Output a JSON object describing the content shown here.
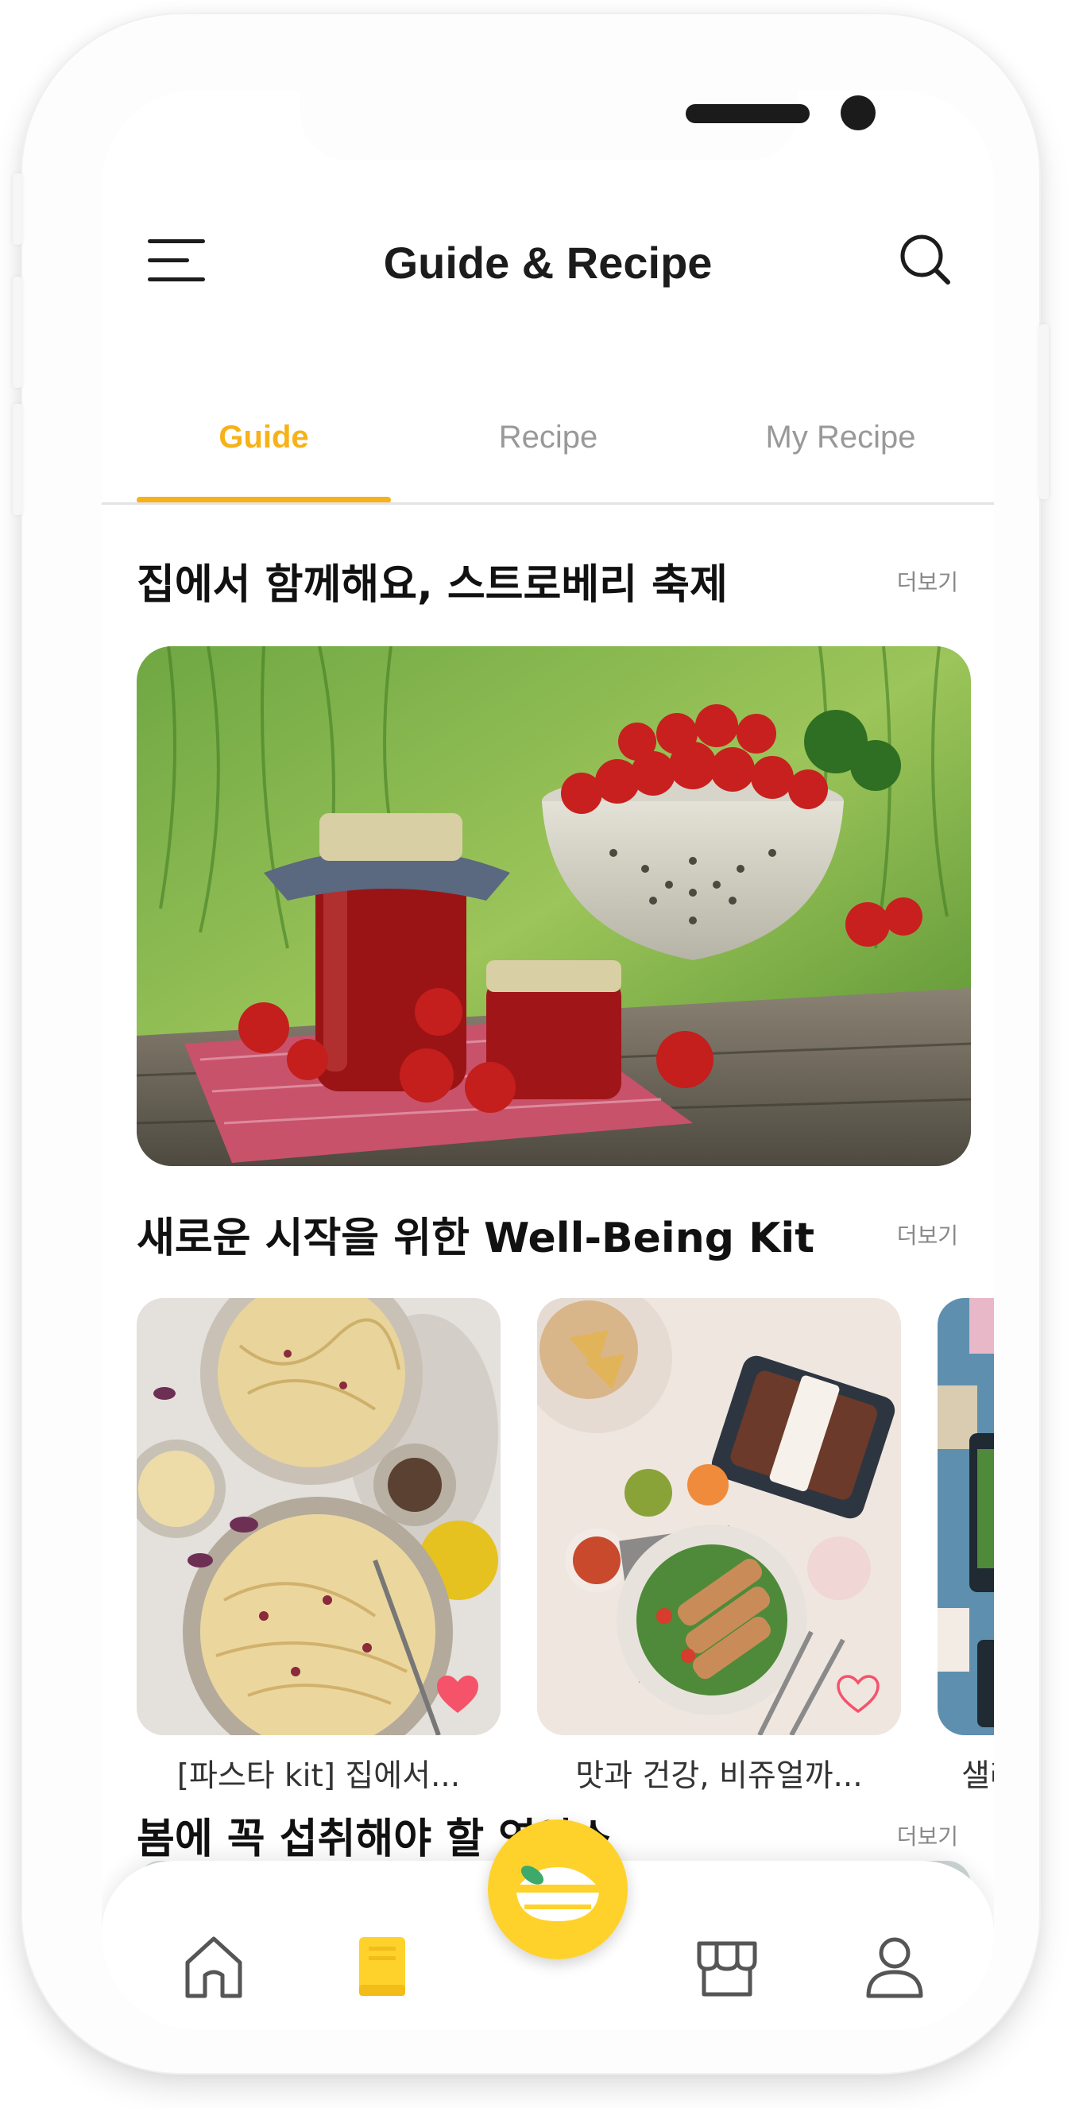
{
  "header": {
    "title": "Guide & Recipe"
  },
  "tabs": [
    {
      "label": "Guide",
      "active": true
    },
    {
      "label": "Recipe",
      "active": false
    },
    {
      "label": "My Recipe",
      "active": false
    }
  ],
  "sections": [
    {
      "title": "집에서 함께해요, 스트로베리 축제",
      "more": "더보기"
    },
    {
      "title": "새로운 시작을 위한  Well-Being  Kit",
      "more": "더보기",
      "cards": [
        {
          "caption": "[파스타 kit] 집에서...",
          "liked": true
        },
        {
          "caption": "맛과 건강, 비쥬얼까...",
          "liked": false
        },
        {
          "caption": "샐러"
        }
      ]
    },
    {
      "title": "봄에 꼭 섭취해야 할 영양소",
      "more": "더보기"
    }
  ],
  "colors": {
    "accent": "#f7b218",
    "fab": "#fed22a",
    "heart": "#f5536a"
  },
  "bottom_nav": [
    "home-icon",
    "book-icon",
    "fab-bowl-icon",
    "store-icon",
    "profile-icon"
  ]
}
